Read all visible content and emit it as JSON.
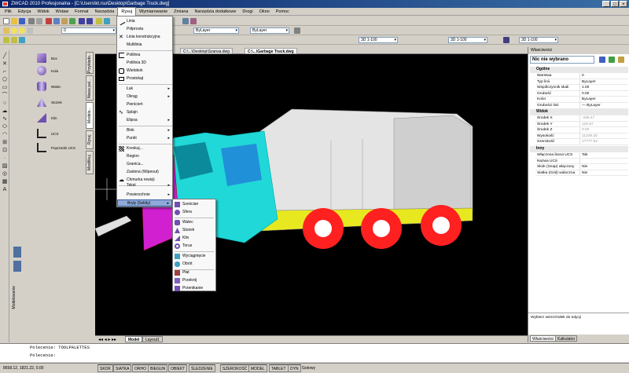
{
  "window": {
    "title": "ZWCAD 2010 Profesjonalna - [C:\\Users\\kt.rsu\\Desktop\\Garbage Truck.dwg]",
    "buttons": [
      "_",
      "□",
      "×"
    ]
  },
  "menubar": [
    "Plik",
    "Edycja",
    "Widok",
    "Wstaw",
    "Format",
    "Narzędzia",
    "Rysuj",
    "Wymiarowanie",
    "Zmiana",
    "Narzędzia dodatkowe",
    "Drogi",
    "Okno",
    "Pomoc"
  ],
  "toolbar": {
    "layer_combo": "0",
    "linetype_combo": "ByLayer",
    "lineweight_combo": "ByLayer",
    "scale1": "3D 1-100",
    "scale2": "3D 1-100",
    "scale3": "3D 1-100"
  },
  "draw_menu": {
    "items": [
      "Linia",
      "Półprosta",
      "Linia konstrukcyjna",
      "Multilinia",
      "Polilinia",
      "Polilinia 3D",
      "Wielobok",
      "Prostokąt",
      "Łuk",
      "Okrąg",
      "Pierścień",
      "Splajn",
      "Elipsa",
      "Blok",
      "Punkt",
      "Kreskuj...",
      "Region",
      "Granica...",
      "Zasłona (Wipeout)",
      "Chmurka rewizji",
      "Tekst",
      "Powierzchnie",
      "Bryły (Solidy)"
    ]
  },
  "solids_menu": {
    "items": [
      "Sześcian",
      "Sfera",
      "Walec",
      "Stożek",
      "Klin",
      "Torus",
      "Wyciągnięcie",
      "Obrót",
      "Płat",
      "Przekrój",
      "Przenikanie"
    ]
  },
  "palette": {
    "items": [
      "Box",
      "Kula",
      "Walec",
      "Stożek",
      "Klin",
      "UCS",
      "Poprzedni UCS"
    ],
    "tabs": [
      "Przykłado...",
      "Nowa pal...",
      "Modelo...",
      "Rysuj",
      "Modifikuj"
    ],
    "bottom_label": "Modelowanie"
  },
  "doc_tabs": [
    "C:\\...\\Desktop\\Szansa.dwg",
    "C:\\...\\Garbage Truck.dwg"
  ],
  "layout_tabs": [
    "Model",
    "Layout1"
  ],
  "properties": {
    "header": "Właściwości",
    "selection": "Nic nie wybrano",
    "cat_general": "Ogólne",
    "general": [
      [
        "Warstwa",
        "0"
      ],
      [
        "Typ linii",
        "ByLayer"
      ],
      [
        "Współczynnik skali",
        "1.00"
      ],
      [
        "Grubość",
        "0.00"
      ],
      [
        "Kolor",
        "ByLayer"
      ],
      [
        "Grubości linii",
        "— ByLayer"
      ]
    ],
    "cat_view": "Widok",
    "view": [
      [
        "Środek X",
        "-165.47"
      ],
      [
        "Środek Y",
        "120.67"
      ],
      [
        "Środek Z",
        "0.00"
      ],
      [
        "Wysokość",
        "11239.30"
      ],
      [
        "Szerokość",
        "17777.92"
      ]
    ],
    "cat_misc": "Inny",
    "misc": [
      [
        "Włączona ikona UCS",
        "Tak"
      ],
      [
        "Nazwa UCS",
        ""
      ],
      [
        "Skok (Snap) włączony",
        "Nie"
      ],
      [
        "Siatka (Grid) widoczna",
        "Nie"
      ]
    ],
    "hint": "Wybierz wierzchołek do edycji",
    "tabs": [
      "Właściwości",
      "Kalkulator"
    ]
  },
  "command": {
    "line1": "Polecenie: TOOLPALETTES",
    "line2": "Polecenie:"
  },
  "status": {
    "coords": "8658.12, 1821.22, 0.00",
    "buttons": [
      "SKOK",
      "SIATKA",
      "ORHO",
      "BIEGUN",
      "OBIEKT",
      "ŚLEDZENIE",
      "SZEROKOŚĆ",
      "MODEL",
      "TABLET",
      "DYN"
    ],
    "state": "Gotowy"
  },
  "colors": {
    "title": "#0a246a",
    "truck_cab": "#20d8d8",
    "truck_body": "#e0e0e0",
    "wheel": "#ff2020",
    "bumper": "#e8e820",
    "fender": "#d020d0"
  }
}
